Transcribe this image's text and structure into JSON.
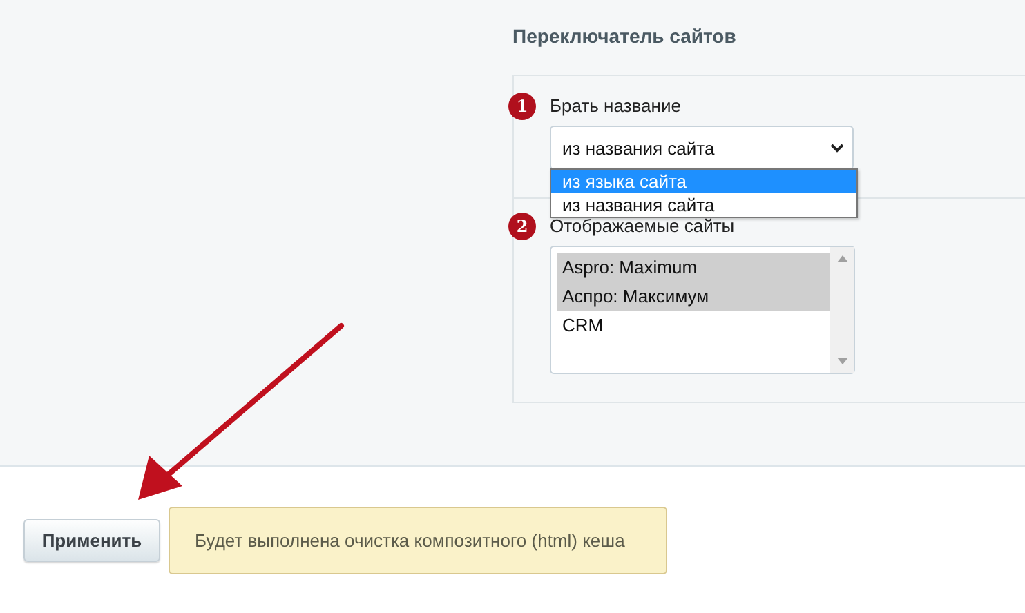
{
  "section_title": "Переключатель сайтов",
  "fields": [
    {
      "kind": "select",
      "step": "1",
      "label": "Брать название",
      "value": "из названия сайта",
      "dropdown": [
        {
          "label": "из языка сайта",
          "highlighted": true
        },
        {
          "label": "из названия сайта",
          "highlighted": false
        }
      ]
    },
    {
      "kind": "listbox",
      "step": "2",
      "label": "Отображаемые сайты",
      "options": [
        {
          "label": "Aspro: Maximum",
          "selected": true
        },
        {
          "label": "Аспро: Максимум",
          "selected": true
        },
        {
          "label": "CRM",
          "selected": false
        }
      ]
    }
  ],
  "apply_button": "Применить",
  "notice": "Будет выполнена очистка композитного (html) кеша"
}
